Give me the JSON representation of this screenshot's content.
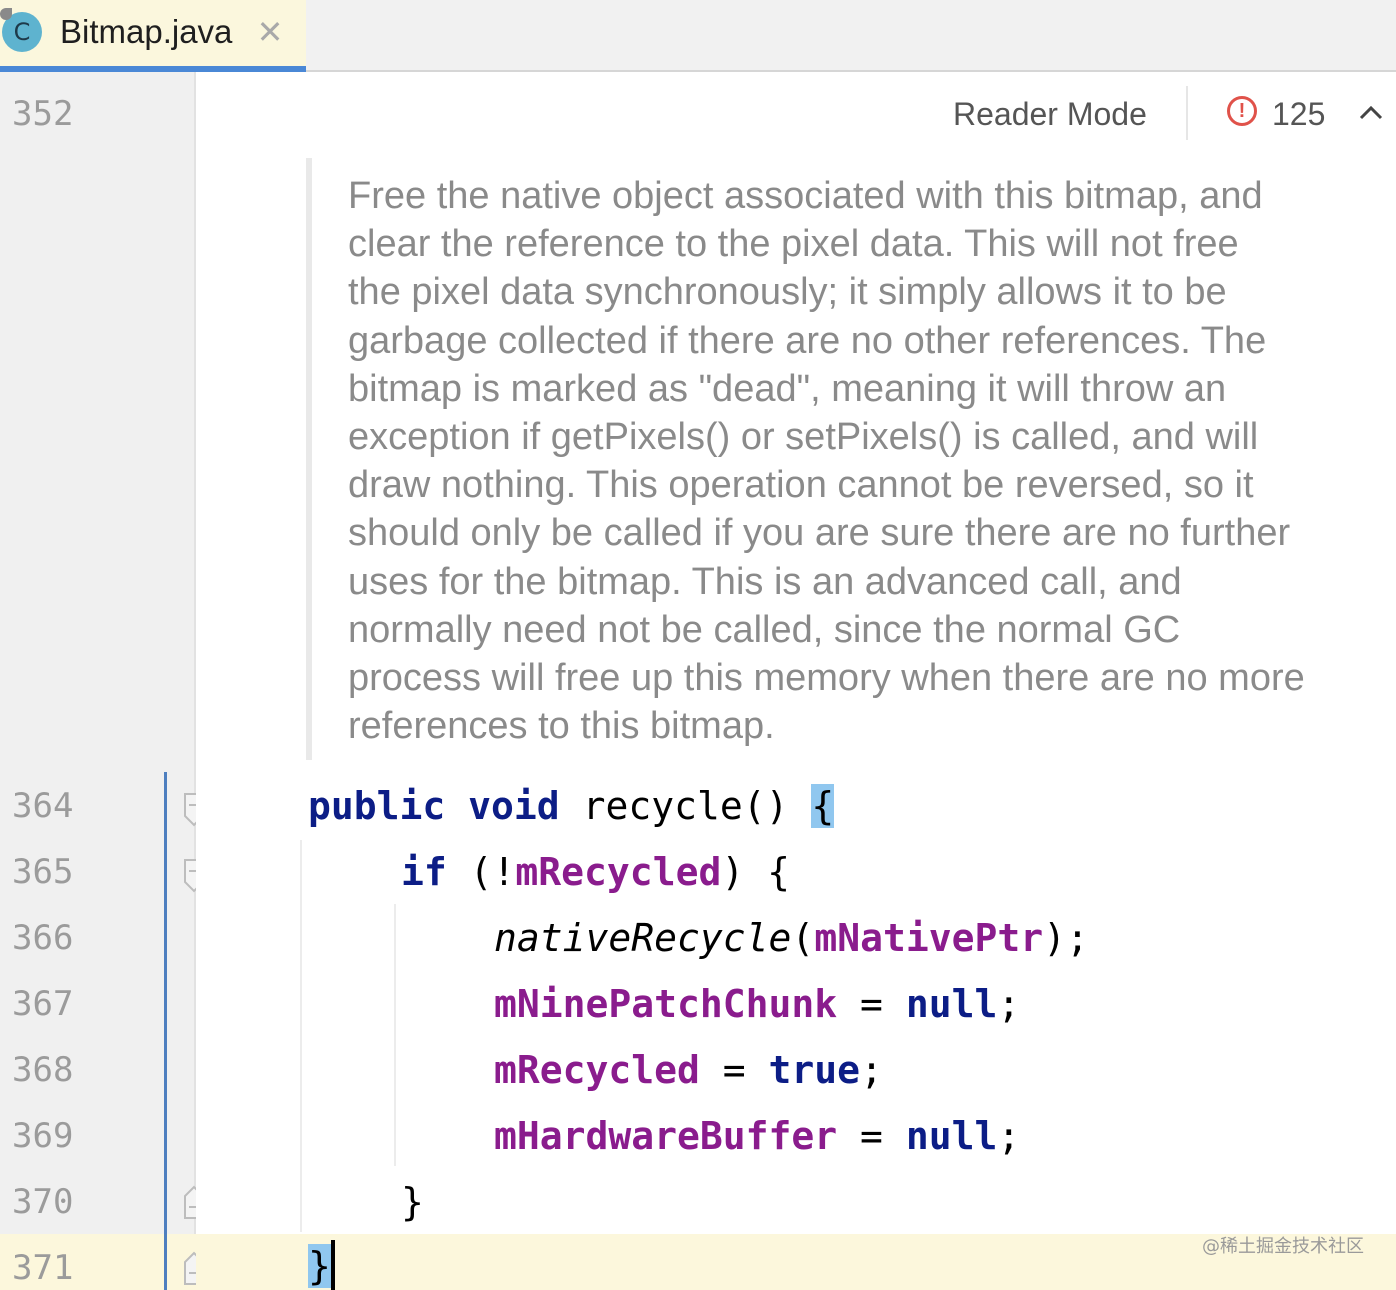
{
  "tab": {
    "icon_letter": "C",
    "title": "Bitmap.java",
    "close_glyph": "✕"
  },
  "toolbar": {
    "reader_mode": "Reader Mode",
    "error_count": "125",
    "error_glyph": "!"
  },
  "gutter": {
    "line_numbers": [
      "352",
      "364",
      "365",
      "366",
      "367",
      "368",
      "369",
      "370",
      "371"
    ]
  },
  "doc_comment": [
    "Free the native object associated with this bitmap, and",
    "clear the reference to the pixel data. This will not free",
    "the pixel data synchronously; it simply allows it to be",
    "garbage collected if there are no other references. The",
    "bitmap is marked as \"dead\", meaning it will throw an",
    "exception if getPixels() or setPixels() is called, and will",
    "draw nothing. This operation cannot be reversed, so it",
    "should only be called if you are sure there are no further",
    "uses for the bitmap. This is an advanced call, and",
    "normally need not be called, since the normal GC",
    "process will free up this memory when there are no more",
    "references to this bitmap."
  ],
  "code": {
    "l364": {
      "kw1": "public",
      "kw2": "void",
      "name": "recycle()",
      "brace": "{"
    },
    "l365": {
      "kw": "if",
      "open": "(!",
      "field": "mRecycled",
      "close": ") {"
    },
    "l366": {
      "method": "nativeRecycle",
      "open": "(",
      "field": "mNativePtr",
      "close": ");"
    },
    "l367": {
      "field": "mNinePatchChunk",
      "op": " = ",
      "kw": "null",
      "end": ";"
    },
    "l368": {
      "field": "mRecycled",
      "op": " = ",
      "kw": "true",
      "end": ";"
    },
    "l369": {
      "field": "mHardwareBuffer",
      "op": " = ",
      "kw": "null",
      "end": ";"
    },
    "l370": {
      "brace": "}"
    },
    "l371": {
      "brace": "}"
    }
  },
  "watermark": "@稀土掘金技术社区",
  "colors": {
    "keyword": "#0c1d86",
    "field": "#8a1c8d",
    "doc_text": "#8a8a8a",
    "line_number": "#9b9b9b",
    "tab_active_underline": "#4a88d6",
    "caret_line": "#fcf7dc",
    "brace_highlight": "#90c7ef",
    "error": "#e0524a"
  }
}
